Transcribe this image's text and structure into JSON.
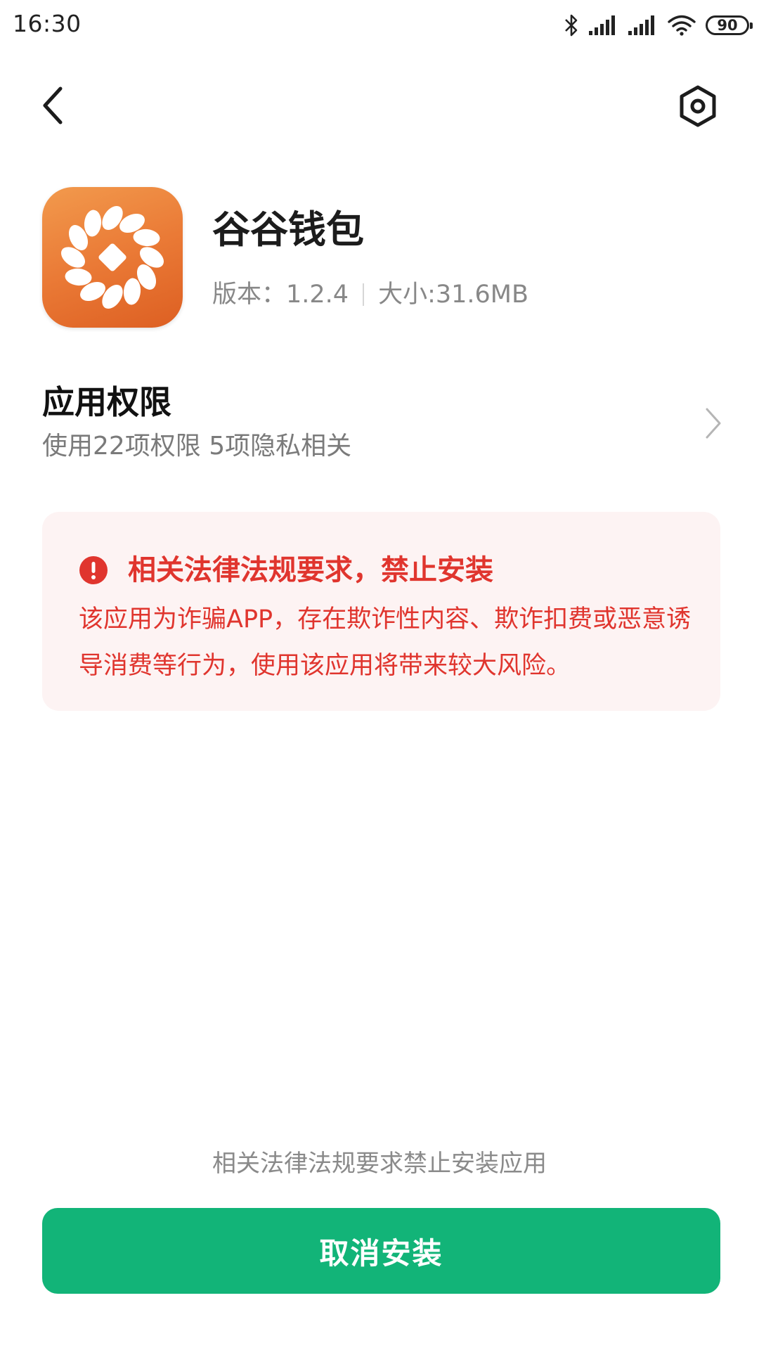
{
  "status_bar": {
    "time": "16:30",
    "battery": "90",
    "icons": [
      "bluetooth-icon",
      "signal-icon",
      "signal-icon",
      "wifi-icon",
      "battery-icon"
    ]
  },
  "nav": {
    "back_icon": "chevron-left-icon",
    "settings_icon": "hexagon-settings-icon"
  },
  "app": {
    "name": "谷谷钱包",
    "version": "版本：1.2.4",
    "size": "大小:31.6MB",
    "icon": "coin-wreath-icon",
    "icon_colors": [
      "#f29a4d",
      "#dd5f22"
    ]
  },
  "permissions": {
    "title": "应用权限",
    "subtitle": "使用22项权限 5项隐私相关"
  },
  "warning": {
    "title": "相关法律法规要求，禁止安装",
    "body": "该应用为诈骗APP，存在欺诈性内容、欺诈扣费或恶意诱导消费等行为，使用该应用将带来较大风险。",
    "color": "#e0352e",
    "background": "#fdf3f3"
  },
  "footer": {
    "note": "相关法律法规要求禁止安装应用",
    "cancel_label": "取消安装",
    "button_color": "#12b478"
  }
}
